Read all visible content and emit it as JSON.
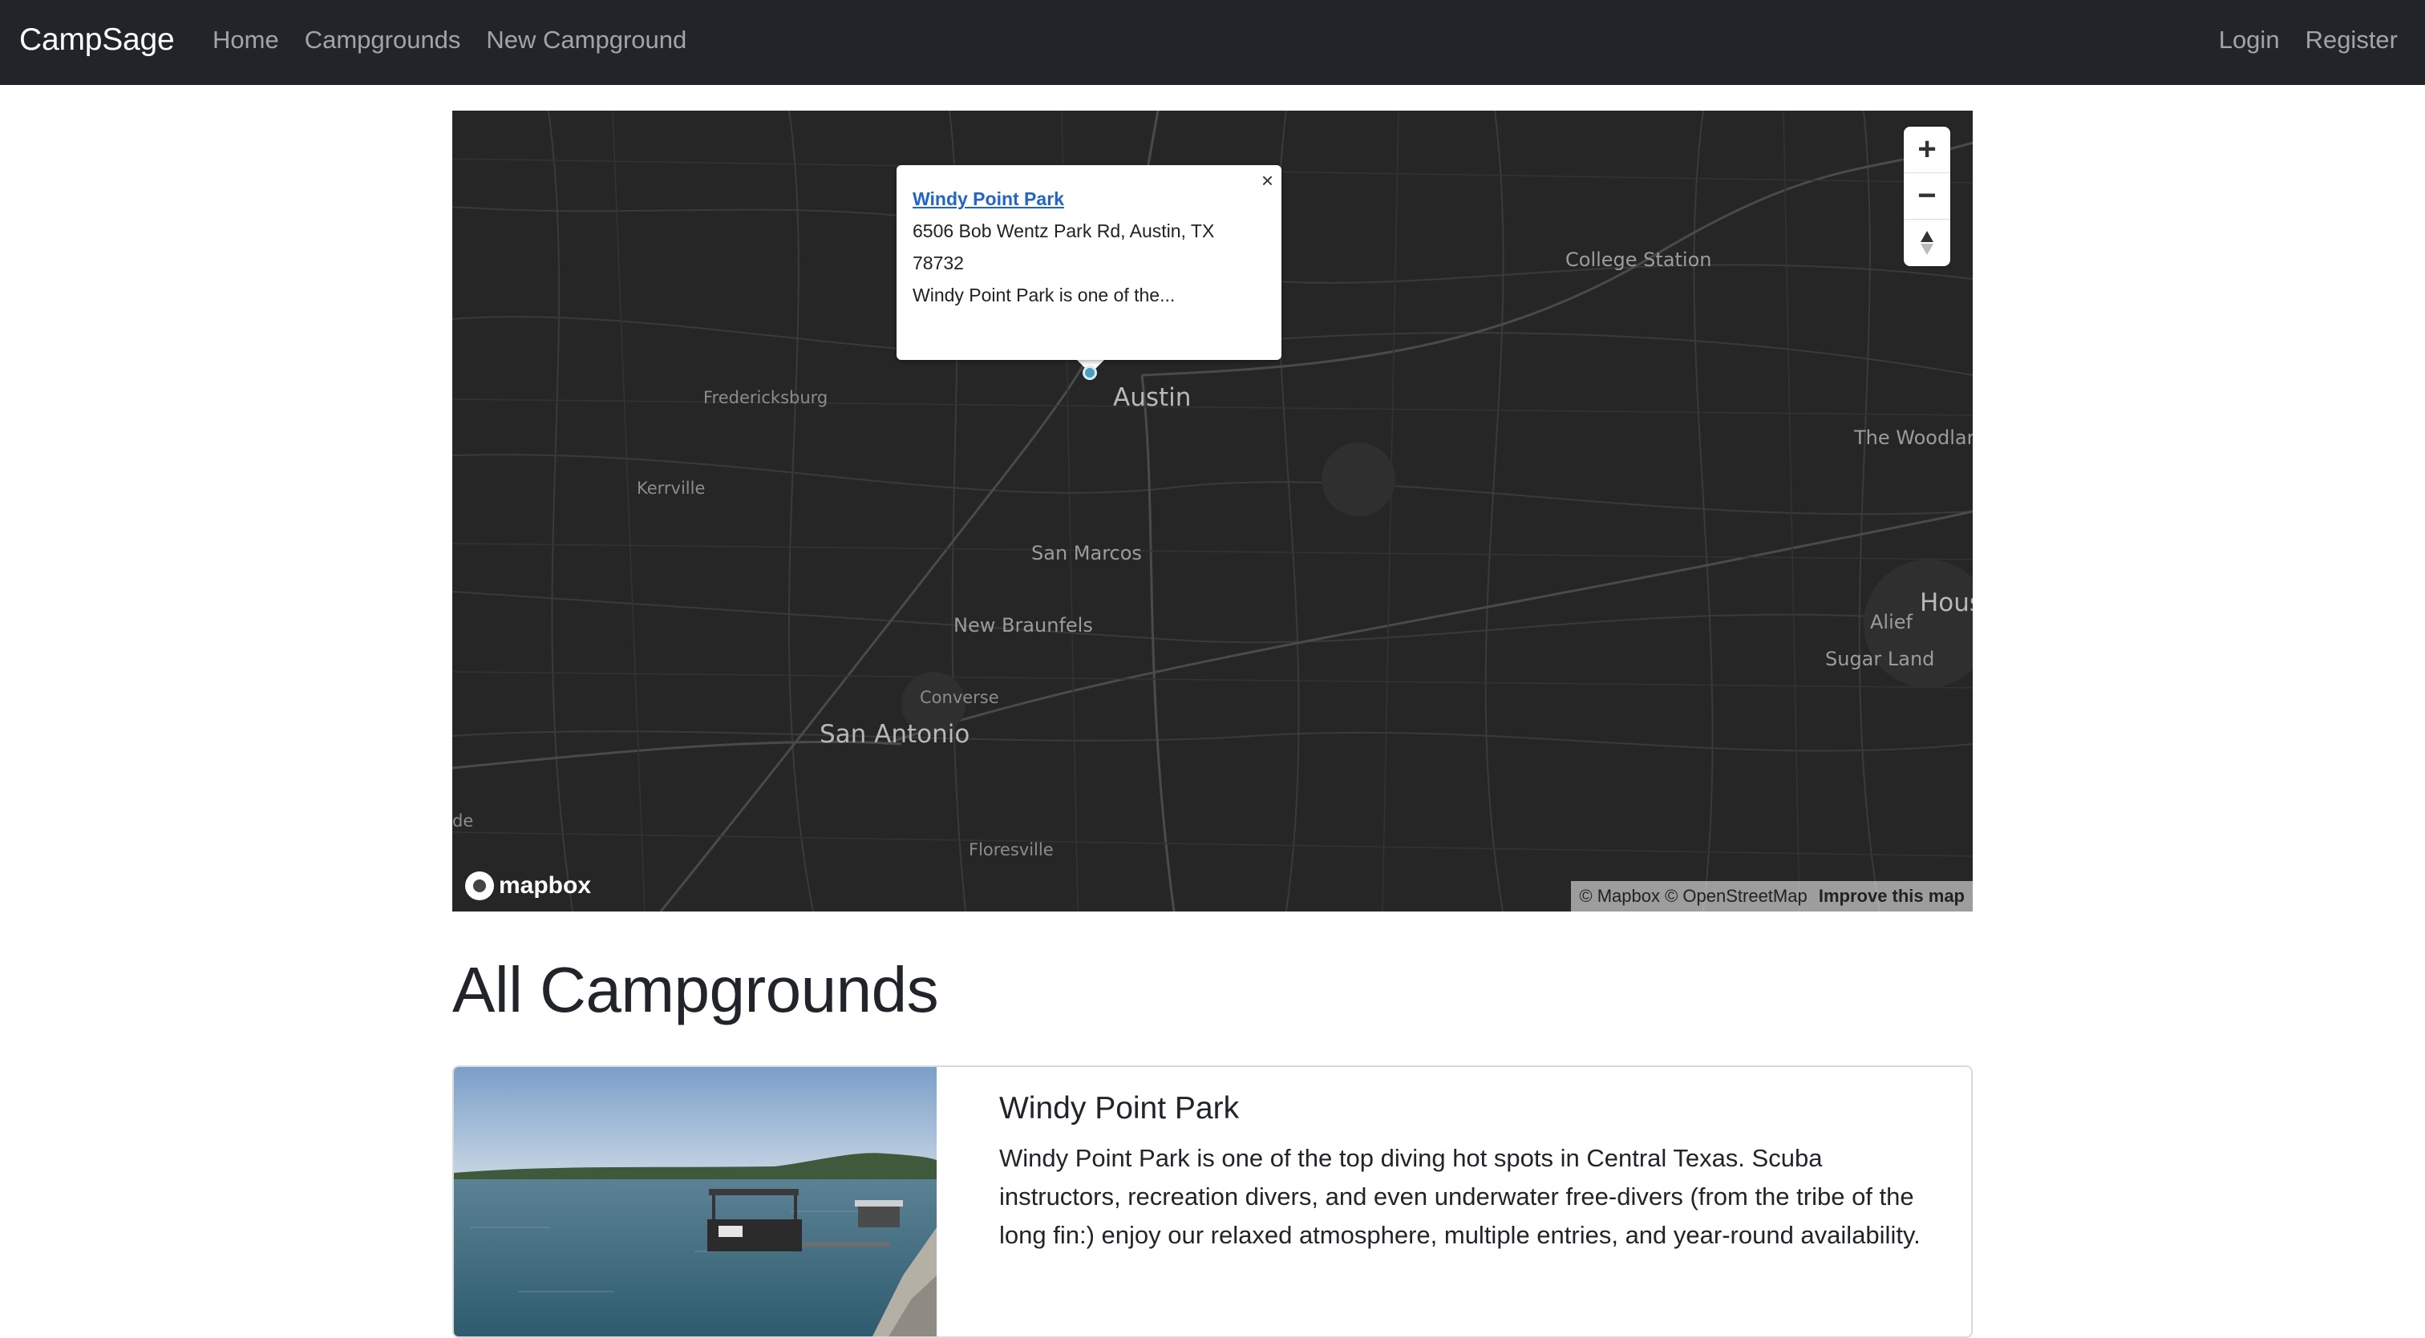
{
  "navbar": {
    "brand": "CampSage",
    "links": [
      "Home",
      "Campgrounds",
      "New Campground"
    ],
    "right_links": [
      "Login",
      "Register"
    ]
  },
  "map": {
    "popup": {
      "title": "Windy Point Park",
      "address_line1": "6506 Bob Wentz Park Rd, Austin, TX",
      "address_line2": "78732",
      "description": "Windy Point Park is one of the...",
      "close": "×"
    },
    "cities": {
      "austin": "Austin",
      "san_antonio": "San Antonio",
      "college_station": "College Station",
      "fredericksburg": "Fredericksburg",
      "kerrville": "Kerrville",
      "san_marcos": "San Marcos",
      "new_braunfels": "New Braunfels",
      "converse": "Converse",
      "floresville": "Floresville",
      "the_woodlands": "The Woodlan",
      "houston": "Hous",
      "alief": "Alief",
      "sugar_land": "Sugar Land",
      "edge_left": "de"
    },
    "controls": {
      "zoom_in": "+",
      "zoom_out": "−",
      "compass": "▲"
    },
    "logo": "mapbox",
    "attribution": {
      "copy": "© Mapbox © OpenStreetMap",
      "improve": "Improve this map"
    },
    "style": "dark"
  },
  "page": {
    "title": "All Campgrounds"
  },
  "campgrounds": [
    {
      "title": "Windy Point Park",
      "description": "Windy Point Park is one of the top diving hot spots in Central Texas. Scuba instructors, recreation divers, and even underwater free-divers (from the tribe of the long fin:) enjoy our relaxed atmosphere, multiple entries, and year-round availability."
    }
  ],
  "colors": {
    "navbar_bg": "#212529",
    "map_bg": "#262626",
    "link_blue": "#1f63d6",
    "marker": "#4a9ec2"
  }
}
